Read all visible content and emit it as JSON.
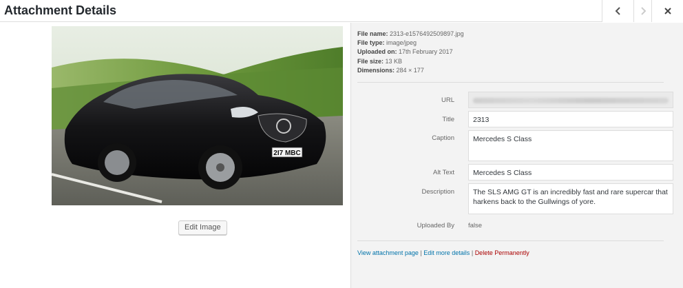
{
  "header": {
    "title": "Attachment Details",
    "prev_icon": "chevron-left-icon",
    "next_icon": "chevron-right-icon",
    "close_icon": "close-icon"
  },
  "preview": {
    "image_alt": "Mercedes S Class",
    "plate_text": "2I7 MBC",
    "edit_button": "Edit Image"
  },
  "meta": {
    "file_name_label": "File name:",
    "file_name": "2313-e1576492509897.jpg",
    "file_type_label": "File type:",
    "file_type": "image/jpeg",
    "uploaded_on_label": "Uploaded on:",
    "uploaded_on": "17th February 2017",
    "file_size_label": "File size:",
    "file_size": "13 KB",
    "dimensions_label": "Dimensions:",
    "dimensions": "284 × 177"
  },
  "fields": {
    "url_label": "URL",
    "title_label": "Title",
    "title_value": "2313",
    "caption_label": "Caption",
    "caption_value": "Mercedes S Class",
    "alt_label": "Alt Text",
    "alt_value": "Mercedes S Class",
    "description_label": "Description",
    "description_value": "The SLS AMG GT is an incredibly fast and rare supercar that harkens back to the Gullwings of yore.",
    "uploaded_by_label": "Uploaded By",
    "uploaded_by_value": "false"
  },
  "actions": {
    "view_page": "View attachment page",
    "sep1": "|",
    "edit_details": "Edit more details",
    "sep2": "|",
    "delete": "Delete Permanently"
  },
  "colors": {
    "link": "#0073aa",
    "delete": "#a00000",
    "panel_bg": "#f3f3f3"
  }
}
